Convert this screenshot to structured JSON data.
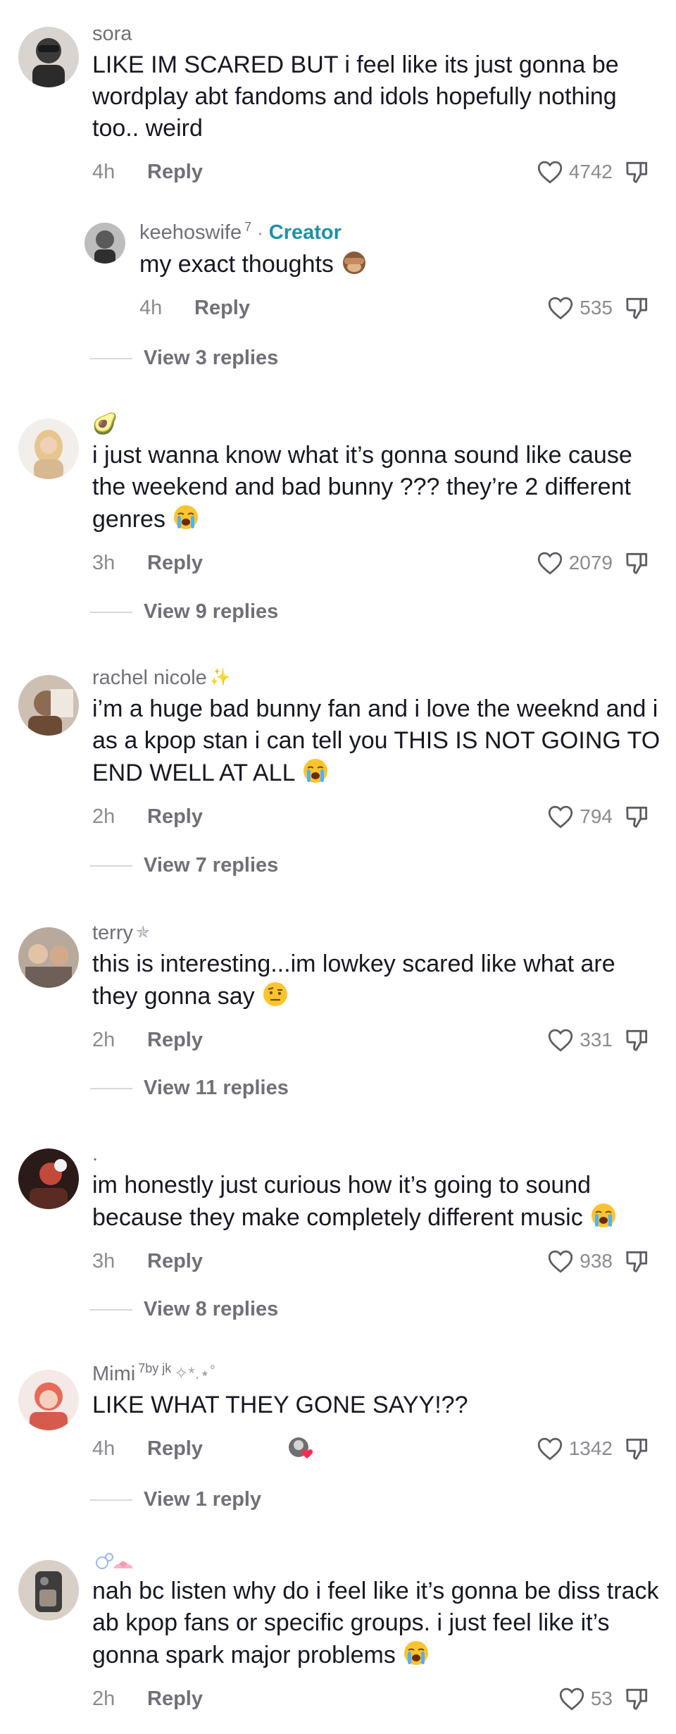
{
  "comments": [
    {
      "username": "sora",
      "text": "LIKE IM SCARED BUT i feel like its just gonna be wordplay abt fandoms and idols hopefully nothing too.. weird",
      "time": "4h",
      "reply_label": "Reply",
      "likes": "4742"
    },
    {
      "username": "keehoswife",
      "username_sup": "7",
      "badge": "Creator",
      "badge_sep": "·",
      "text": "my exact thoughts",
      "time": "4h",
      "reply_label": "Reply",
      "likes": "535",
      "view_replies": "View 3 replies"
    },
    {
      "username": "🥑",
      "text": "i just wanna know what it’s gonna sound like cause the weekend and bad bunny ??? they’re 2 different genres",
      "time": "3h",
      "reply_label": "Reply",
      "likes": "2079",
      "view_replies": "View 9 replies"
    },
    {
      "username": "rachel nicole",
      "username_deco": "✨",
      "text": "i’m a huge bad bunny fan and i love the weeknd and i as a kpop stan i can tell you THIS IS NOT GOING TO END WELL AT ALL",
      "time": "2h",
      "reply_label": "Reply",
      "likes": "794",
      "view_replies": "View 7 replies"
    },
    {
      "username": "terry",
      "username_deco": "✯",
      "text": "this is interesting...im lowkey scared like what are they gonna say",
      "time": "2h",
      "reply_label": "Reply",
      "likes": "331",
      "view_replies": "View 11 replies"
    },
    {
      "username": ".",
      "text": "im honestly just curious how it’s going to sound because they make completely different music",
      "time": "3h",
      "reply_label": "Reply",
      "likes": "938",
      "view_replies": "View 8 replies"
    },
    {
      "username": "Mimi",
      "username_sup": "7by jk",
      "username_deco": "✧*.⋆˚",
      "text": "LIKE WHAT THEY GONE SAYY!??",
      "time": "4h",
      "reply_label": "Reply",
      "likes": "1342",
      "view_replies": "View 1 reply"
    },
    {
      "username": "",
      "text": "nah bc listen why do i feel like it’s gonna be diss track ab kpop fans or specific groups. i just feel like it’s gonna spark major problems",
      "time": "2h",
      "reply_label": "Reply",
      "likes": "53"
    }
  ],
  "icons": {
    "like": "heart-outline-icon",
    "dislike": "thumbs-down-icon",
    "cry": "loudly-crying-face-emoji",
    "monkey": "see-no-evil-monkey-emoji",
    "grimace": "raised-eyebrow-face-emoji"
  }
}
